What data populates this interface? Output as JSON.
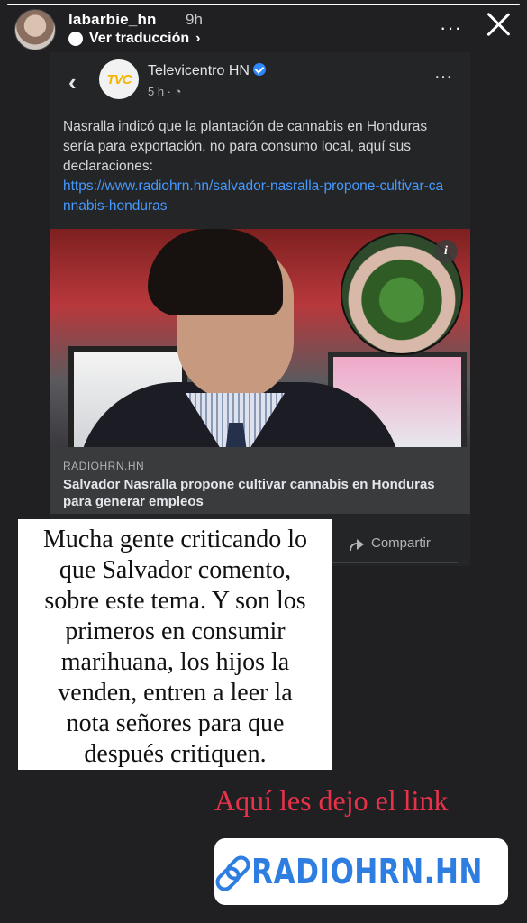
{
  "story": {
    "progress": 1.0,
    "username": "labarbie_hn",
    "time": "9h",
    "translate_label": "Ver traducción",
    "translate_chevron": "›",
    "more_icon": "···"
  },
  "post": {
    "back_icon": "‹",
    "page_logo_text": "TVC",
    "page_name": "Televicentro HN",
    "post_time": "5 h ·",
    "globe_icon": "globe-icon",
    "more_icon": "···",
    "text": "Nasralla indicó que la plantación de cannabis en Honduras sería para exportación, no para consumo local, aquí sus declaraciones:",
    "link": "https://www.radiohrn.hn/salvador-nasralla-propone-cultivar-cannabis-honduras",
    "info_icon": "i",
    "link_domain": "RADIOHRN.HN",
    "link_title": "Salvador Nasralla propone cultivar cannabis en Honduras para generar empleos",
    "share_label": "Compartir"
  },
  "stickers": {
    "caption_lines": [
      "Mucha gente criticando lo",
      "que Salvador comento,",
      "sobre este tema. Y son los",
      "primeros en consumir",
      "marihuana, los hijos la",
      "venden, entren a leer la",
      "nota señores para que",
      "después critiquen."
    ],
    "red_text": "Aquí les dejo el link",
    "link_label": "RADIOHRN.HN"
  },
  "colors": {
    "background": "#202023",
    "link_blue": "#4599ff",
    "red_text": "#e8324a",
    "sticker_blue": "#2e7de0"
  }
}
